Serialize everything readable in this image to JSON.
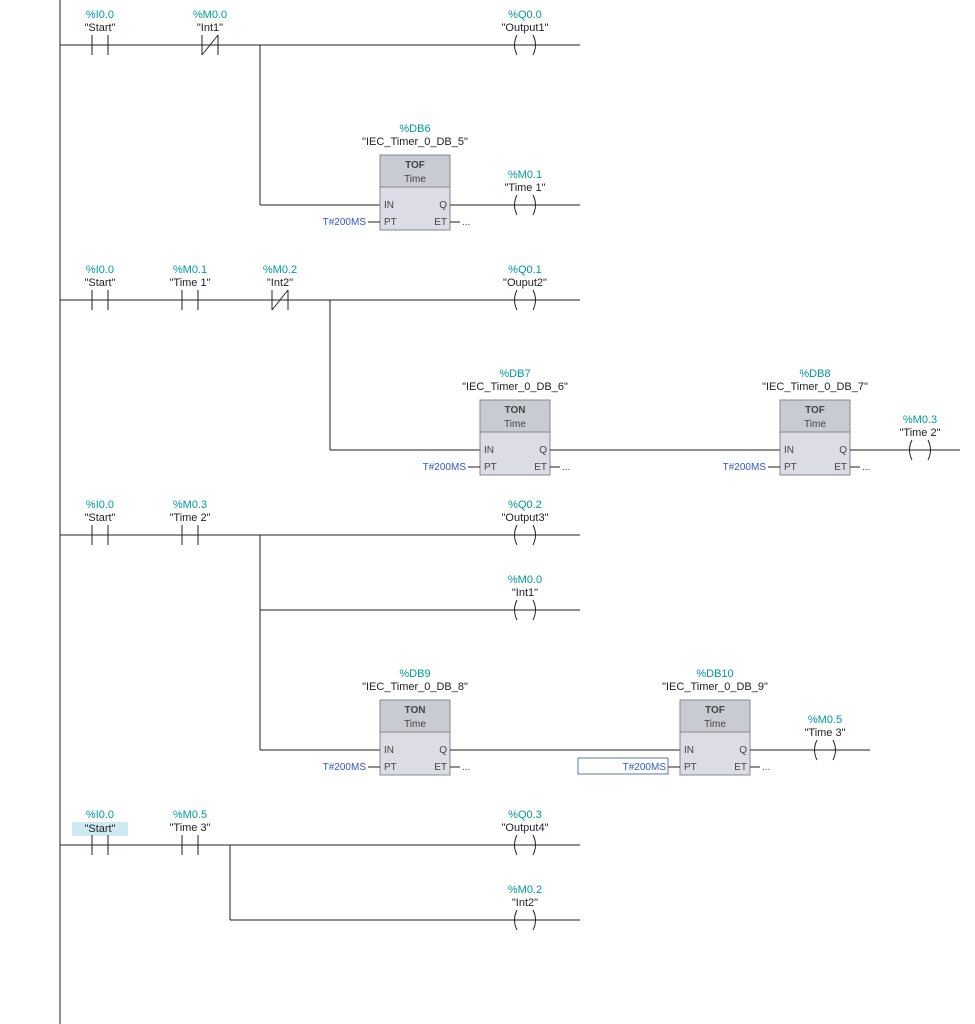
{
  "rung1": {
    "start": {
      "addr": "%I0.0",
      "name": "\"Start\""
    },
    "int1": {
      "addr": "%M0.0",
      "name": "\"Int1\""
    },
    "out1": {
      "addr": "%Q0.0",
      "name": "\"Output1\""
    },
    "timer": {
      "db": "%DB6",
      "dbname": "\"IEC_Timer_0_DB_5\"",
      "type": "TOF",
      "sub": "Time",
      "pt": "T#200MS"
    },
    "time1": {
      "addr": "%M0.1",
      "name": "\"Time 1\""
    }
  },
  "rung2": {
    "start": {
      "addr": "%I0.0",
      "name": "\"Start\""
    },
    "time1": {
      "addr": "%M0.1",
      "name": "\"Time 1\""
    },
    "int2": {
      "addr": "%M0.2",
      "name": "\"Int2\""
    },
    "out2": {
      "addr": "%Q0.1",
      "name": "\"Ouput2\""
    },
    "timerA": {
      "db": "%DB7",
      "dbname": "\"IEC_Timer_0_DB_6\"",
      "type": "TON",
      "sub": "Time",
      "pt": "T#200MS"
    },
    "timerB": {
      "db": "%DB8",
      "dbname": "\"IEC_Timer_0_DB_7\"",
      "type": "TOF",
      "sub": "Time",
      "pt": "T#200MS"
    },
    "time2": {
      "addr": "%M0.3",
      "name": "\"Time 2\""
    }
  },
  "rung3": {
    "start": {
      "addr": "%I0.0",
      "name": "\"Start\""
    },
    "time2": {
      "addr": "%M0.3",
      "name": "\"Time 2\""
    },
    "out3": {
      "addr": "%Q0.2",
      "name": "\"Output3\""
    },
    "int1": {
      "addr": "%M0.0",
      "name": "\"Int1\""
    },
    "timerA": {
      "db": "%DB9",
      "dbname": "\"IEC_Timer_0_DB_8\"",
      "type": "TON",
      "sub": "Time",
      "pt": "T#200MS"
    },
    "timerB": {
      "db": "%DB10",
      "dbname": "\"IEC_Timer_0_DB_9\"",
      "type": "TOF",
      "sub": "Time",
      "pt": "T#200MS"
    },
    "time3": {
      "addr": "%M0.5",
      "name": "\"Time 3\""
    }
  },
  "rung4": {
    "start": {
      "addr": "%I0.0",
      "name": "\"Start\""
    },
    "time3": {
      "addr": "%M0.5",
      "name": "\"Time 3\""
    },
    "out4": {
      "addr": "%Q0.3",
      "name": "\"Output4\""
    },
    "int2": {
      "addr": "%M0.2",
      "name": "\"Int2\""
    }
  },
  "pins": {
    "in": "IN",
    "q": "Q",
    "pt": "PT",
    "et": "ET",
    "etval": "..."
  }
}
